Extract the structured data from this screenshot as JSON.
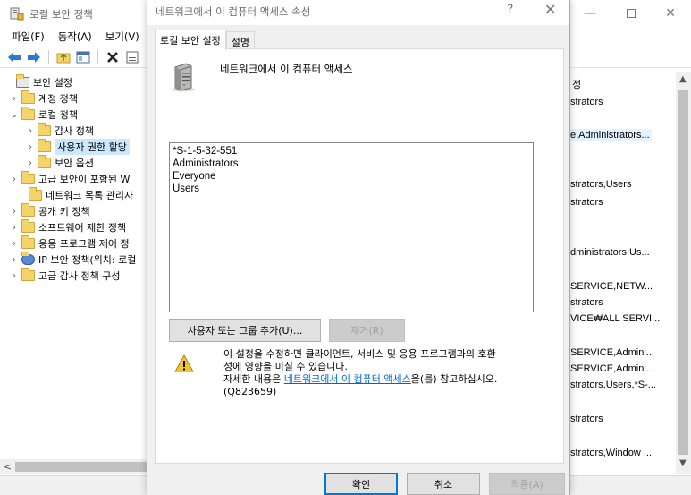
{
  "main_window": {
    "title": "로컬 보안 정책",
    "controls": {
      "minimize": "—",
      "close": "✕"
    },
    "menu": [
      "파일(F)",
      "동작(A)",
      "보기(V)"
    ]
  },
  "tree": {
    "items": [
      {
        "label": "보안 설정",
        "expander": "",
        "icon": "security-settings-icon"
      },
      {
        "label": "계정 정책",
        "expander": ">",
        "icon": "folder-icon"
      },
      {
        "label": "로컬 정책",
        "expander": "v",
        "icon": "folder-open-icon"
      },
      {
        "label": "감사 정책",
        "expander": ">",
        "icon": "folder-icon"
      },
      {
        "label": "사용자 권한 할당",
        "expander": ">",
        "icon": "folder-icon",
        "selected": true
      },
      {
        "label": "보안 옵션",
        "expander": ">",
        "icon": "folder-icon"
      },
      {
        "label": "고급 보안이 포함된 W",
        "expander": ">",
        "icon": "folder-icon"
      },
      {
        "label": "네트워크 목록 관리자",
        "expander": "",
        "icon": "folder-icon"
      },
      {
        "label": "공개 키 정책",
        "expander": ">",
        "icon": "folder-icon"
      },
      {
        "label": "소프트웨어 제한 정책",
        "expander": ">",
        "icon": "folder-icon"
      },
      {
        "label": "응용 프로그램 제어 정",
        "expander": ">",
        "icon": "folder-icon"
      },
      {
        "label": "IP 보안 정책(위치: 로컬",
        "expander": ">",
        "icon": "ip-security-icon"
      },
      {
        "label": "고급 감사 정책 구성",
        "expander": ">",
        "icon": "folder-icon"
      }
    ]
  },
  "right_pane": {
    "column_header": "정",
    "cells": [
      "strators",
      "e,Administrators...",
      "strators,Users",
      "strators",
      "dministrators,Us...",
      "SERVICE,NETW...",
      "strators",
      "VICE₩ALL SERVI...",
      "SERVICE,Admini...",
      "SERVICE,Admini...",
      "strators,Users,*S-...",
      "strators",
      "strators,Window ..."
    ]
  },
  "dialog": {
    "title": "네트워크에서 이 컴퓨터 액세스 속성",
    "help": "?",
    "close": "✕",
    "tabs": [
      "로컬 보안 설정",
      "설명"
    ],
    "policy_name": "네트워크에서 이 컴퓨터 액세스",
    "accounts": [
      "*S-1-5-32-551",
      "Administrators",
      "Everyone",
      "Users"
    ],
    "add_button": "사용자 또는 그룹 추가(U)...",
    "remove_button": "제거(R)",
    "warning_line1": "이 설정을 수정하면 클라이언트, 서비스 및 응용 프로그램과의 호환",
    "warning_line2": "성에 영향을 미칠 수 있습니다.",
    "warning_line3_prefix": "자세한 내용은 ",
    "warning_link": "네트워크에서 이 컴퓨터 액세스",
    "warning_line3_suffix": "을(를) 참고하십시오.",
    "warning_line4": "(Q823659)",
    "ok_button": "확인",
    "cancel_button": "취소",
    "apply_button": "적용(A)"
  },
  "colors": {
    "accent": "#0078d7",
    "link": "#0066cc",
    "selection": "#cce8ff"
  }
}
